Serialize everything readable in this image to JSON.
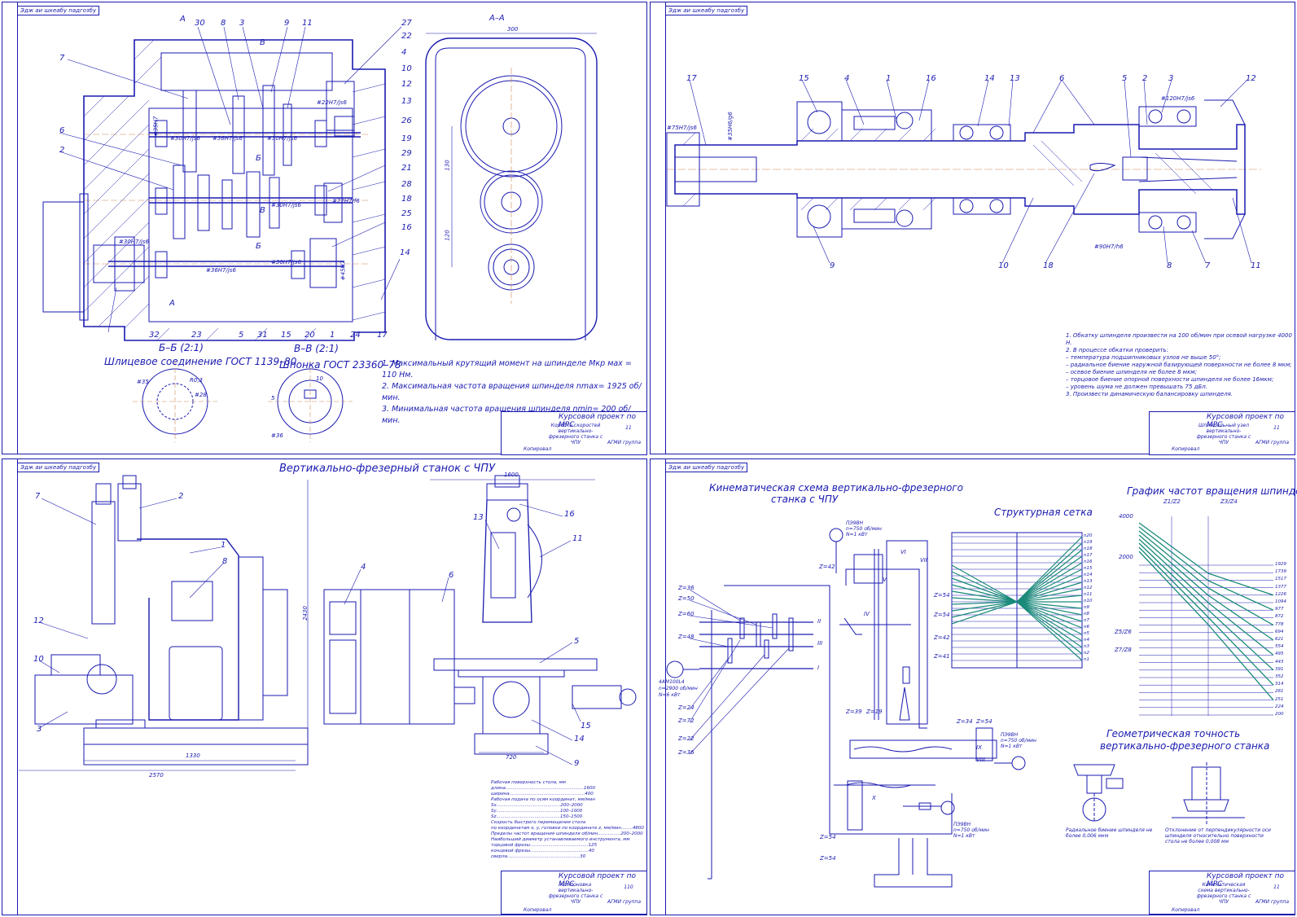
{
  "sheets": [
    {
      "stamp": "Эдж аи шкеабу падгозбу",
      "section_title": "А–А",
      "dimension_top": "300",
      "dimensions_side": [
        "130",
        "120"
      ],
      "bb_title": "Б–Б (2:1)",
      "bb_caption": "Шлицевое соединение ГОСТ 1139–80",
      "bb_dims": [
        "#35",
        "R0,3",
        "#28"
      ],
      "vv_title": "В–В (2:1)",
      "vv_caption": "Шпонка ГОСТ 23360–78",
      "vv_dims": [
        "10",
        "5",
        "#36"
      ],
      "section_marks": [
        "А",
        "В",
        "Б",
        "В",
        "Б",
        "А"
      ],
      "fits": [
        "#30H7/js6",
        "#36H7/js6",
        "#30H7/js6",
        "#22H7/js6",
        "#30H7/js6",
        "#36H7/js6",
        "#30H7/js6",
        "#30H7/js6",
        "#22H7/f6",
        "#45H7",
        "#35H7"
      ],
      "callouts_top": [
        "30",
        "8",
        "3",
        "9",
        "11",
        "27",
        "22",
        "4",
        "10",
        "12",
        "13",
        "26",
        "19",
        "29"
      ],
      "callouts_left": [
        "7",
        "6",
        "2"
      ],
      "callouts_right": [
        "21",
        "28",
        "18",
        "25",
        "16",
        "14"
      ],
      "callouts_bottom": [
        "32",
        "23",
        "5",
        "31",
        "15",
        "20",
        "1",
        "24",
        "17"
      ],
      "notes": [
        "1. Максимальный крутящий момент на шпинделе Мкр мах = 110 Нм.",
        "2. Максимальная частота вращения шпинделя nmax= 1925 об/мин.",
        "3. Минимальная частота вращения шпинделя nmin= 200 об/мин."
      ],
      "tb_header": "Курсовой проект по МРС",
      "tb_name": "Коробка скоростей вертикально-фрезерного станка с ЧПУ",
      "tb_sheet": "11",
      "tb_org": "АГМИ группа",
      "tb_bottom": "Копировал"
    },
    {
      "stamp": "Эдж аи шкеабу падгозбу",
      "callouts_top": [
        "17",
        "15",
        "4",
        "1",
        "16",
        "14",
        "13",
        "6",
        "5",
        "2",
        "3",
        "12"
      ],
      "callouts_bottom": [
        "9",
        "10",
        "18",
        "8",
        "7",
        "11"
      ],
      "fits": [
        "#75H7/js6",
        "#35H6/g6",
        "#90H7/h6",
        "#120H7/js6"
      ],
      "notes": [
        "1. Обкатку шпинделя произвести на 100 об/мин при осевой нагрузке 4000 Н.",
        "2. В процессе обкатки проверить:",
        "– температура подшипниковых узлов не выше 50°;",
        "– радиальное биение наружной базирующей поверхности не более 8 мкм;",
        "– осевое биение шпинделя не более 8 мкм;",
        "– торцовое биение опорной поверхности шпинделя не более 16мкм;",
        "– уровень шума не должен превышать 75 дБл.",
        "3. Произвести динамическую балансировку шпинделя."
      ],
      "tb_header": "Курсовой проект по МРС",
      "tb_name": "Шпиндельный узел вертикально-фрезерного станка с ЧПУ",
      "tb_sheet": "11",
      "tb_org": "АГМИ группа",
      "tb_bottom": "Копировал"
    },
    {
      "stamp": "Эдж аи шкеабу падгозбу",
      "title": "Вертикально-фрезерный станок с ЧПУ",
      "callouts_left": [
        "7",
        "2",
        "1",
        "8",
        "12",
        "10",
        "3"
      ],
      "callouts_mid": [
        "4",
        "6"
      ],
      "callouts_right": [
        "16",
        "13",
        "11",
        "5",
        "15",
        "14",
        "9"
      ],
      "dims": [
        "1600",
        "2430",
        "1330",
        "2570",
        "720"
      ],
      "specs": [
        "Рабочая поверхность стола, мм",
        "длина.......................................................1600",
        "ширина.....................................................400",
        "Рабочая подача по осям координат, мм/мин",
        "Sx.............................................200–2000",
        "Sy.............................................100–1000",
        "Sz.............................................150–1500",
        "Скорость быстрого перемещения стола",
        "по координатам x, y, головки по координате z, мм/мин........4800",
        "Пределы частот вращения шпинделя об/мин................200–2000",
        "Наибольший диаметр устанавливаемого инструмента, мм",
        "торцовой фрезы.........................................125",
        "концевой фрезы.........................................40",
        "сверла...................................................30"
      ],
      "tb_header": "Курсовой проект по МРС",
      "tb_name": "Компоновка вертикально-фрезерного станка с ЧПУ",
      "tb_sheet": "110",
      "tb_org": "АГМИ группа",
      "tb_bottom": "Копировал"
    },
    {
      "stamp": "Эдж аи шкеабу падгозбу",
      "kin_title_1": "Кинематическая схема вертикально-фрезерного",
      "kin_title_2": "станка  с ЧПУ",
      "grid_title": "Структурная сетка",
      "graph_title": "График частот вращения шпинделя",
      "geo_title_1": "Геометрическая точность",
      "geo_title_2": "вертикально-фрезерного станка",
      "motor_main": [
        "4AМ100L4",
        "n=2900 об/мин",
        "N=6 кВт"
      ],
      "motor_small": [
        "ПЭ9ВН",
        "n=750 об/мин",
        "N=1 кВт"
      ],
      "gears_left": [
        "Z=36",
        "Z=50",
        "Z=60",
        "Z=48",
        "Z=24",
        "Z=72",
        "Z=22",
        "Z=36"
      ],
      "gears_right": [
        "Z=42",
        "Z=54",
        "Z=54",
        "Z=42",
        "Z=41",
        "Z=39",
        "Z=19",
        "Z=34",
        "Z=54",
        "Z=54",
        "Z=54"
      ],
      "shafts": [
        "I",
        "II",
        "III",
        "IV",
        "V",
        "VI",
        "VII",
        "VIII",
        "IX",
        "X"
      ],
      "grid_speeds": [
        "n20",
        "n19",
        "n18",
        "n17",
        "n16",
        "n15",
        "n14",
        "n13",
        "n12",
        "n11",
        "n10",
        "n9",
        "n8",
        "n7",
        "n6",
        "n5",
        "n4",
        "n3",
        "n2",
        "n1"
      ],
      "graph_speeds": [
        "1929",
        "1739",
        "1517",
        "1377",
        "1226",
        "1094",
        "977",
        "872",
        "778",
        "694",
        "621",
        "554",
        "495",
        "443",
        "391",
        "352",
        "314",
        "281",
        "251",
        "224",
        "200"
      ],
      "graph_y": [
        "4000",
        "2000"
      ],
      "ratio_labels": [
        "Z1/Z2",
        "Z3/Z4",
        "Z5/Z6",
        "Z7/Z8"
      ],
      "geo_cap_1": "Радиальное биение шпинделя не более 0,006 мкм",
      "geo_cap_2": "Отклонение от перпендикулярности оси шпинделя относительно поверхности стола не более 0,008 мм",
      "tb_header": "Курсовой проект по МРС",
      "tb_name": "Кинематическая схема вертикально-фрезерного станка с ЧПУ",
      "tb_sheet": "11",
      "tb_org": "АГМИ группа",
      "tb_bottom": "Копировал"
    }
  ]
}
